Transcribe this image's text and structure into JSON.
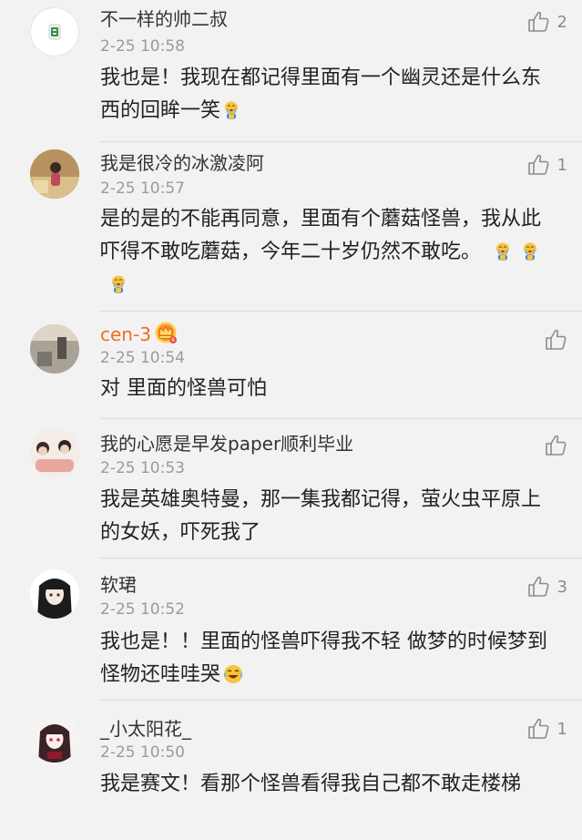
{
  "comments": [
    {
      "name": "不一样的帅二叔",
      "time": "2-25 10:58",
      "text": "我也是！我现在都记得里面有一个幽灵还是什么东西的回眸一笑",
      "likes": "2",
      "emojis": [
        "crying-face-emoji"
      ]
    },
    {
      "name": "我是很冷的冰激凌阿",
      "time": "2-25 10:57",
      "text": "是的是的不能再同意，里面有个蘑菇怪兽，我从此吓得不敢吃蘑菇，今年二十岁仍然不敢吃。",
      "likes": "1",
      "emojis": [
        "crying-face-emoji",
        "crying-face-emoji",
        "crying-face-emoji"
      ]
    },
    {
      "name": "cen-3",
      "time": "2-25 10:54",
      "text": "对 里面的怪兽可怕",
      "likes": "",
      "emojis": []
    },
    {
      "name": "我的心愿是早发paper顺利毕业",
      "time": "2-25 10:53",
      "text": "我是英雄奥特曼，那一集我都记得，萤火虫平原上的女妖，吓死我了",
      "likes": "",
      "emojis": []
    },
    {
      "name": "软珺",
      "time": "2-25 10:52",
      "text": "我也是！！里面的怪兽吓得我不轻 做梦的时候梦到怪物还哇哇哭",
      "likes": "3",
      "emojis": [
        "laughing-tears-emoji"
      ]
    },
    {
      "name": "_小太阳花_",
      "time": "2-25 10:50",
      "text": "我是赛文！看那个怪兽看得我自己都不敢走楼梯",
      "likes": "1",
      "emojis": []
    }
  ],
  "colors": {
    "background": "#f2f2f2",
    "vip_name": "#f26d20",
    "time": "#9a9a9a",
    "divider": "#dcdcdc"
  },
  "icons": [
    "like-thumb-icon",
    "vip-crown-badge-icon"
  ]
}
